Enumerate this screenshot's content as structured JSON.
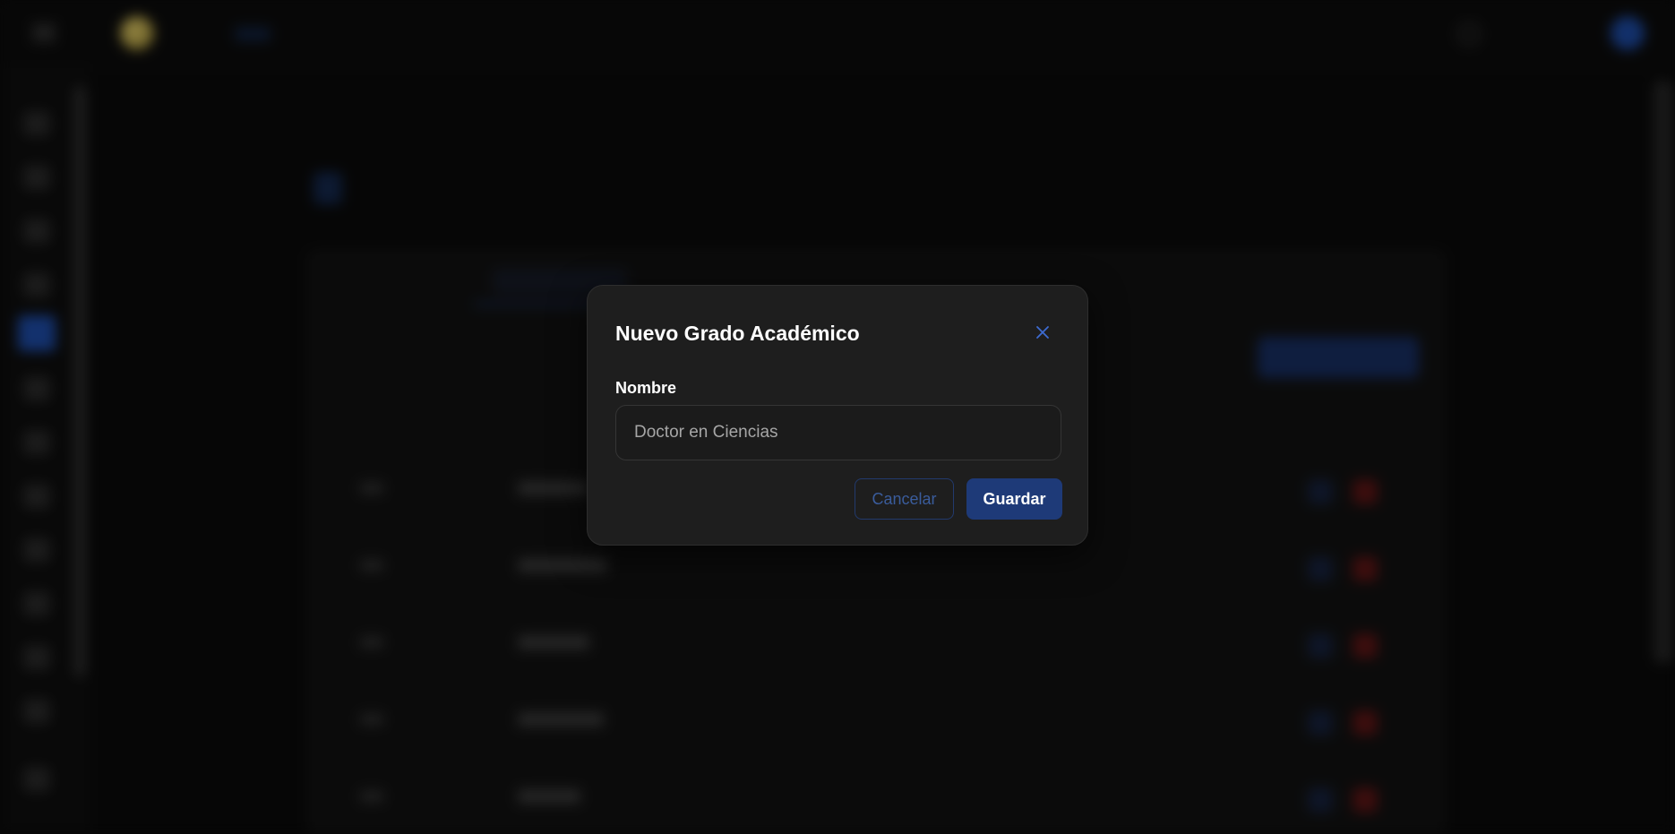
{
  "colors": {
    "modal_bg": "#1e1e1e",
    "primary": "#1e3a78",
    "close_icon": "#3d6bd1",
    "cancel_text": "#3a5c9c",
    "background": "#0a0a0a"
  },
  "icons": {
    "close": "close-icon",
    "menu": "menu-icon",
    "bell": "bell-icon"
  },
  "modal": {
    "title": "Nuevo Grado Académico",
    "name_label": "Nombre",
    "name_placeholder": "Doctor en Ciencias",
    "name_value": "",
    "cancel_label": "Cancelar",
    "save_label": "Guardar"
  }
}
